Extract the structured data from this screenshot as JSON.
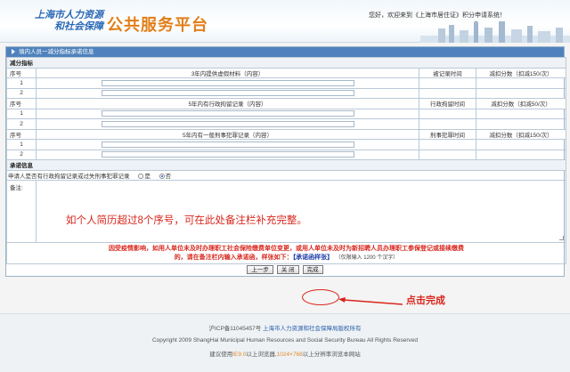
{
  "header": {
    "logo_line1": "上海市人力资源",
    "logo_line2": "和社会保障",
    "platform": "公共服务平台",
    "welcome": "您好，欢迎来到《上海市居住证》积分申请系统！"
  },
  "panel": {
    "title": "填内人员一减分指标承诺信息",
    "section_deduct": "减分指标",
    "groups": [
      {
        "col_no": "序号",
        "col_content": "3年内提供虚假材料（内容）",
        "col_time": "被记录时间",
        "col_score": "减扣分数（扣减150/次）",
        "rows": [
          "1",
          "2"
        ]
      },
      {
        "col_no": "序号",
        "col_content": "5年内有行政拘留记录（内容）",
        "col_time": "行政拘留时间",
        "col_score": "减扣分数（扣减50/次）",
        "rows": [
          "1",
          "2"
        ]
      },
      {
        "col_no": "序号",
        "col_content": "5年内有一般刑事犯罪记录（内容）",
        "col_time": "刑事犯罪时间",
        "col_score": "减扣分数（扣减150/次）",
        "rows": [
          "1",
          "2"
        ]
      }
    ],
    "section_promise": "承诺信息",
    "question": "申请人是否有行政拘留记录或过失刑事犯罪记录",
    "option_yes": "是",
    "option_no": "否",
    "remark_label": "备注:",
    "remark_text": "如个人简历超过8个序号，可在此处备注栏补充完整。",
    "notice_line1": "因受疫情影响，如用人单位未及时办理职工社会保险缴费单位变更，或用人单位未及时为新招聘人员办理职工参保登记或接续缴费",
    "notice_line2_a": "的，请在备注栏内输入承诺函，样张如下：",
    "notice_link": "【承诺函样张】",
    "notice_small": "（仅限输入 1200 个汉字）",
    "buttons": {
      "prev": "上一步",
      "close": "关 闭",
      "finish": "完成"
    },
    "click_note": "点击完成"
  },
  "footer": {
    "icp": "沪ICP备11045457号",
    "owner": "上海市人力资源和社会保障局版权所有",
    "copyright": "Copyright 2009 ShangHai Municipal Human Resources and Social Security Bureau All Rights Reserved",
    "tip_a": "建议使用",
    "tip_ie": "IE9.0",
    "tip_b": "以上浏览器,",
    "tip_res": "1024×768",
    "tip_c": "以上分辨率浏览本网站"
  }
}
